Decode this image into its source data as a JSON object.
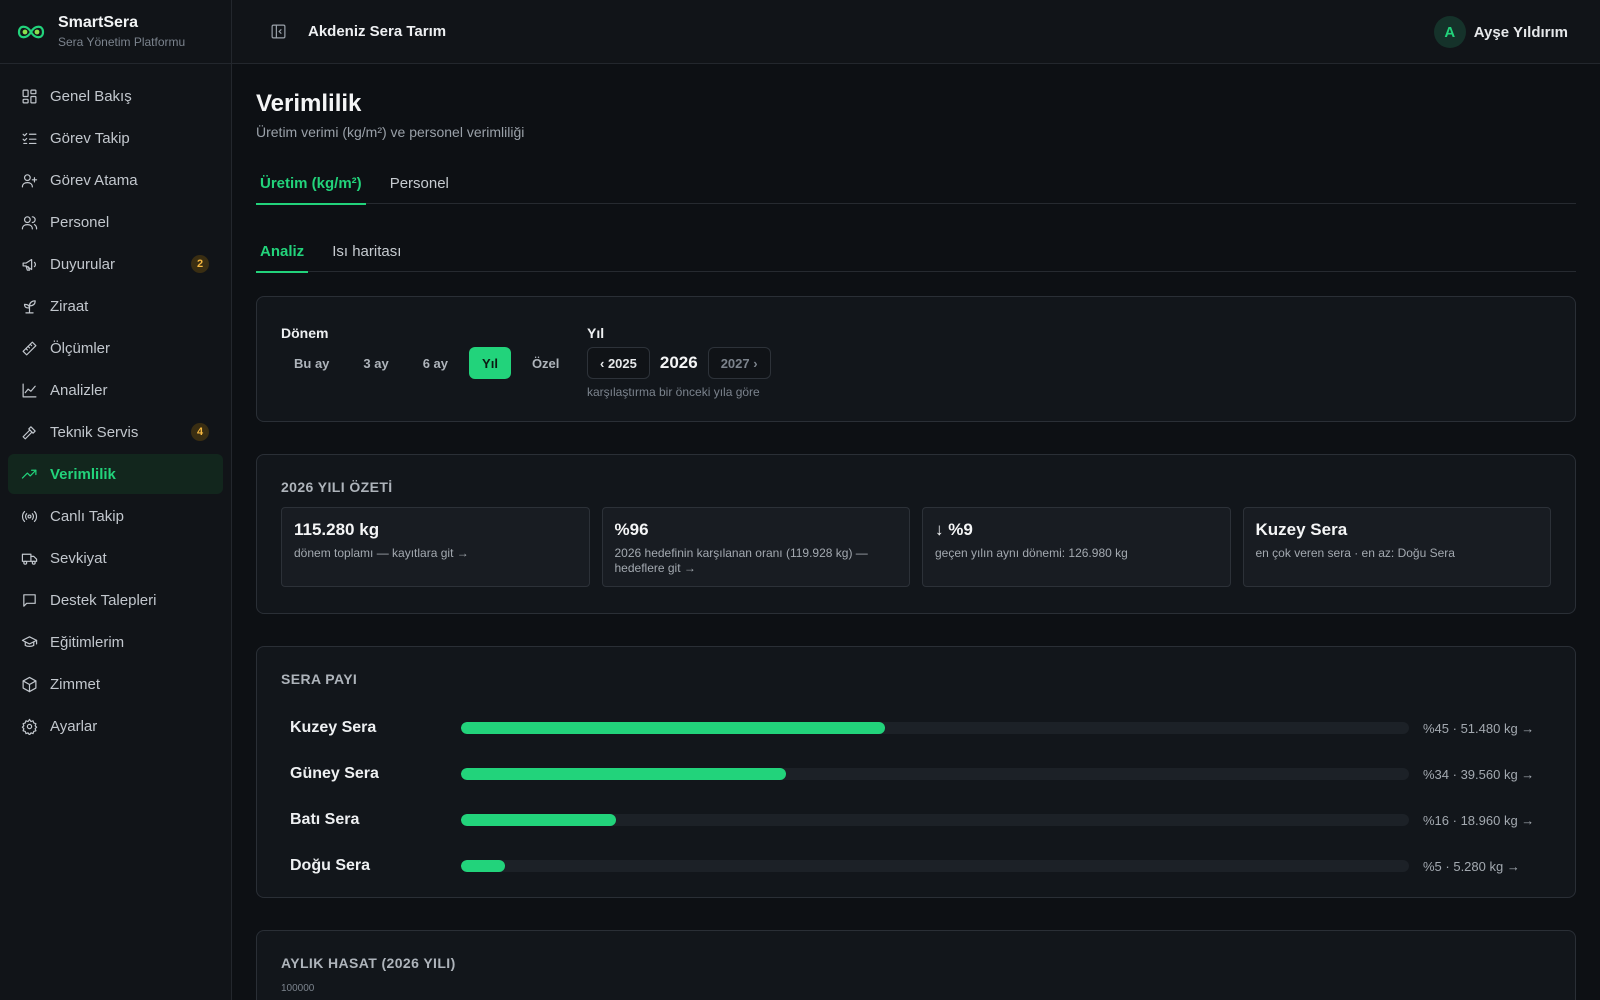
{
  "brand": {
    "name": "SmartSera",
    "subtitle": "Sera Yönetim Platformu"
  },
  "colors": {
    "accent": "#22d37b",
    "badge": "#f5b740",
    "background": "#0d1014"
  },
  "sidebar": {
    "items": [
      {
        "label": "Genel Bakış",
        "icon": "grid-icon"
      },
      {
        "label": "Görev Takip",
        "icon": "checklist-icon"
      },
      {
        "label": "Görev Atama",
        "icon": "user-plus-icon"
      },
      {
        "label": "Personel",
        "icon": "users-icon"
      },
      {
        "label": "Duyurular",
        "icon": "megaphone-icon",
        "badge": "2"
      },
      {
        "label": "Ziraat",
        "icon": "sprout-icon"
      },
      {
        "label": "Ölçümler",
        "icon": "ruler-icon"
      },
      {
        "label": "Analizler",
        "icon": "line-chart-icon"
      },
      {
        "label": "Teknik Servis",
        "icon": "hammer-icon",
        "badge": "4"
      },
      {
        "label": "Verimlilik",
        "icon": "trending-up-icon",
        "active": true
      },
      {
        "label": "Canlı Takip",
        "icon": "radio-icon"
      },
      {
        "label": "Sevkiyat",
        "icon": "truck-icon"
      },
      {
        "label": "Destek Talepleri",
        "icon": "message-icon"
      },
      {
        "label": "Eğitimlerim",
        "icon": "graduation-cap-icon"
      },
      {
        "label": "Zimmet",
        "icon": "box-icon"
      },
      {
        "label": "Ayarlar",
        "icon": "gear-icon"
      }
    ]
  },
  "header": {
    "org": "Akdeniz Sera Tarım",
    "user_initial": "A",
    "user_name": "Ayşe Yıldırım"
  },
  "page": {
    "title": "Verimlilik",
    "subtitle": "Üretim verimi (kg/m²) ve personel verimliliği"
  },
  "tabs": [
    {
      "label": "Üretim (kg/m²)"
    },
    {
      "label": "Personel"
    }
  ],
  "subtabs": [
    {
      "label": "Analiz"
    },
    {
      "label": "Isı haritası"
    }
  ],
  "filters": {
    "period_label": "Dönem",
    "periods": [
      "Bu ay",
      "3 ay",
      "6 ay",
      "Yıl",
      "Özel"
    ],
    "active_period": "Yıl",
    "year_label": "Yıl",
    "prev_year": "‹ 2025",
    "current_year": "2026",
    "next_year": "2027 ›",
    "year_note": "karşılaştırma bir önceki yıla göre"
  },
  "summary": {
    "title": "2026 YILI ÖZETİ",
    "kpis": [
      {
        "value": "115.280 kg",
        "desc": "dönem toplamı — kayıtlara git →"
      },
      {
        "value": "%96",
        "desc": "2026 hedefinin karşılanan oranı (119.928 kg) — hedeflere git →"
      },
      {
        "value": "↓ %9",
        "desc": "geçen yılın aynı dönemi: 126.980 kg"
      },
      {
        "value": "Kuzey Sera",
        "desc": "en çok veren sera · en az: Doğu Sera"
      }
    ]
  },
  "share": {
    "title": "SERA PAYI",
    "rows": [
      {
        "name": "Kuzey Sera",
        "percent": 44.7,
        "label": "%45 · 51.480 kg →"
      },
      {
        "name": "Güney Sera",
        "percent": 34.3,
        "label": "%34 · 39.560 kg →"
      },
      {
        "name": "Batı Sera",
        "percent": 16.4,
        "label": "%16 · 18.960 kg →"
      },
      {
        "name": "Doğu Sera",
        "percent": 4.6,
        "label": "%5 · 5.280 kg →"
      }
    ]
  },
  "harvest": {
    "title": "AYLIK HASAT (2026 YILI)",
    "tick": "100000"
  }
}
